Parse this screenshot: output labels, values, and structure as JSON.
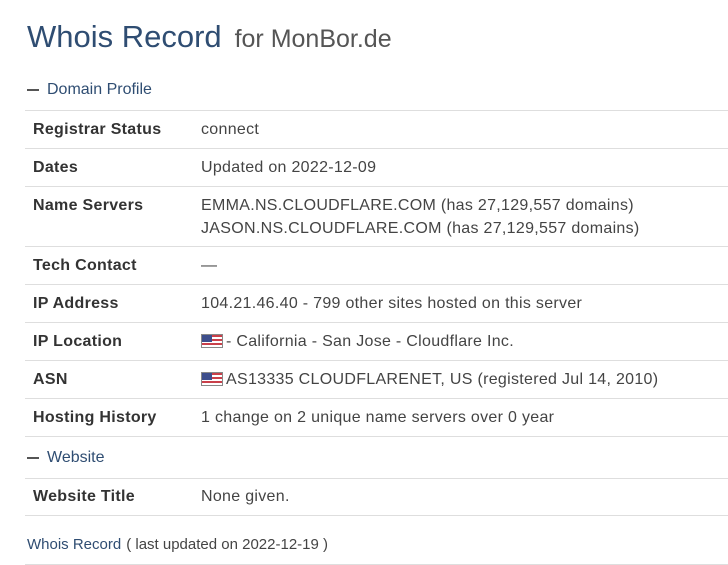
{
  "header": {
    "title": "Whois Record",
    "subtitle": "for MonBor.de"
  },
  "domain_profile": {
    "heading": "Domain Profile",
    "rows": [
      {
        "key": "Registrar Status",
        "value": "connect"
      },
      {
        "key": "Dates",
        "value": "Updated on 2022-12-09"
      },
      {
        "key": "Name Servers",
        "value": "EMMA.NS.CLOUDFLARE.COM (has 27,129,557 domains)",
        "value2": "JASON.NS.CLOUDFLARE.COM (has 27,129,557 domains)"
      },
      {
        "key": "Tech Contact",
        "value": "—"
      },
      {
        "key": "IP Address",
        "value": "104.21.46.40 - 799 other sites hosted on this server"
      },
      {
        "key": "IP Location",
        "value": "- California - San Jose - Cloudflare Inc.",
        "icon": "us-flag-icon"
      },
      {
        "key": "ASN",
        "value": "AS13335 CLOUDFLARENET, US (registered Jul 14, 2010)",
        "icon": "us-flag-icon"
      },
      {
        "key": "Hosting History",
        "value": "1 change on 2 unique name servers over 0 year"
      }
    ]
  },
  "website": {
    "heading": "Website",
    "rows": [
      {
        "key": "Website Title",
        "value": "None given."
      }
    ]
  },
  "footer": {
    "link": "Whois Record",
    "meta": "( last updated on 2022-12-19 )"
  },
  "colors": {
    "accent": "#2f4d72",
    "divider": "#dedede"
  }
}
